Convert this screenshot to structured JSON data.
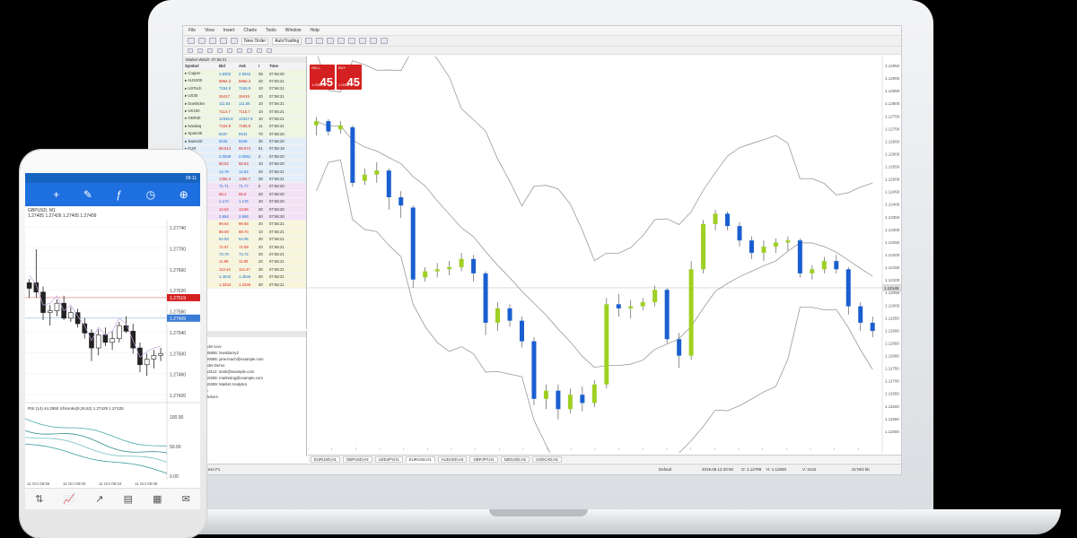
{
  "desktop": {
    "menu": [
      "File",
      "View",
      "Insert",
      "Charts",
      "Tools",
      "Window",
      "Help"
    ],
    "toolbar": {
      "new_order": "New Order",
      "auto_trading": "AutoTrading"
    },
    "market_watch": {
      "title": "Market Watch: 07:56:21",
      "headers": [
        "Symbol",
        "Bid",
        "Ask",
        "!",
        "Time"
      ],
      "rows": [
        {
          "symbol": "Copper",
          "bid": "2.8303",
          "ask": "2.8342",
          "spread": "39",
          "time": "07:56:20",
          "color": "green",
          "dir": "up"
        },
        {
          "symbol": "AUS200",
          "bid": "5964.3",
          "ask": "5966.3",
          "spread": "20",
          "time": "07:56:21",
          "color": "green",
          "dir": "dn"
        },
        {
          "symbol": "USTech",
          "bid": "7154.9",
          "ask": "7155.9",
          "spread": "10",
          "time": "07:56:21",
          "color": "green",
          "dir": "up"
        },
        {
          "symbol": "US30",
          "bid": "26417",
          "ask": "26419",
          "spread": "20",
          "time": "07:56:21",
          "color": "green",
          "dir": "dn"
        },
        {
          "symbol": "Dowlndex",
          "bid": "111.54",
          "ask": "111.55",
          "spread": "10",
          "time": "07:56:21",
          "color": "green",
          "dir": "up"
        },
        {
          "symbol": "UK100",
          "bid": "7114.7",
          "ask": "7115.7",
          "spread": "10",
          "time": "07:56:21",
          "color": "green",
          "dir": "dn"
        },
        {
          "symbol": "GER30",
          "bid": "12346.9",
          "ask": "12347.9",
          "spread": "10",
          "time": "07:56:21",
          "color": "green",
          "dir": "up"
        },
        {
          "symbol": "Nasdaq",
          "bid": "7154.8",
          "ask": "7155.9",
          "spread": "11",
          "time": "07:56:21",
          "color": "green",
          "dir": "dn"
        },
        {
          "symbol": "Spain35",
          "bid": "9437",
          "ask": "9444",
          "spread": "70",
          "time": "07:56:20",
          "color": "green",
          "dir": "up"
        },
        {
          "symbol": "Swiss20",
          "bid": "9245",
          "ask": "9248",
          "spread": "30",
          "time": "07:56:20",
          "color": "blue",
          "dir": "up"
        },
        {
          "symbol": "EUR",
          "bid": "88.813",
          "ask": "88.874",
          "spread": "61",
          "time": "07:56:19",
          "color": "blue",
          "dir": "dn"
        },
        {
          "symbol": "GBP",
          "bid": "2.0049",
          "ask": "2.0051",
          "spread": "2",
          "time": "07:56:20",
          "color": "blue",
          "dir": "up"
        },
        {
          "symbol": "USD",
          "bid": "88.53",
          "ask": "88.63",
          "spread": "10",
          "time": "07:56:20",
          "color": "blue",
          "dir": "dn"
        },
        {
          "symbol": "JPY",
          "bid": "14.78",
          "ask": "14.82",
          "spread": "40",
          "time": "07:56:21",
          "color": "blue",
          "dir": "up"
        },
        {
          "symbol": "CHF",
          "bid": "1356.4",
          "ask": "1356.7",
          "spread": "30",
          "time": "07:56:21",
          "color": "blue",
          "dir": "dn"
        },
        {
          "symbol": "Gold",
          "bid": "71.71",
          "ask": "71.77",
          "spread": "6",
          "time": "07:56:20",
          "color": "pink",
          "dir": "up"
        },
        {
          "symbol": "Silver",
          "bid": "65.4",
          "ask": "65.6",
          "spread": "20",
          "time": "07:56:20",
          "color": "pink",
          "dir": "dn"
        },
        {
          "symbol": "Brent",
          "bid": "1.172",
          "ask": "1.176",
          "spread": "40",
          "time": "07:56:20",
          "color": "pink",
          "dir": "up"
        },
        {
          "symbol": "WTI",
          "bid": "13.54",
          "ask": "13.56",
          "spread": "20",
          "time": "07:56:20",
          "color": "pink",
          "dir": "dn"
        },
        {
          "symbol": "NatGas",
          "bid": "2.654",
          "ask": "2.659",
          "spread": "50",
          "time": "07:56:20",
          "color": "pink",
          "dir": "up"
        },
        {
          "symbol": "EURUSD",
          "bid": "99.64",
          "ask": "99.66",
          "spread": "20",
          "time": "07:56:21",
          "color": "yellow",
          "dir": "dn"
        },
        {
          "symbol": "GBPUSD",
          "bid": "88.69",
          "ask": "88.70",
          "spread": "10",
          "time": "07:56:21",
          "color": "yellow",
          "dir": "dn"
        },
        {
          "symbol": "USDJPY",
          "bid": "64.93",
          "ask": "64.95",
          "spread": "20",
          "time": "07:56:21",
          "color": "yellow",
          "dir": "up"
        },
        {
          "symbol": "AUDUSD",
          "bid": "72.57",
          "ask": "72.59",
          "spread": "20",
          "time": "07:56:21",
          "color": "yellow",
          "dir": "dn"
        },
        {
          "symbol": "USDCAD",
          "bid": "73.70",
          "ask": "73.72",
          "spread": "20",
          "time": "07:56:21",
          "color": "yellow",
          "dir": "up"
        },
        {
          "symbol": "NZDUSD",
          "bid": "11.88",
          "ask": "11.90",
          "spread": "20",
          "time": "07:56:21",
          "color": "yellow",
          "dir": "dn"
        },
        {
          "symbol": "EURGBP",
          "bid": "112.44",
          "ask": "112.47",
          "spread": "30",
          "time": "07:56:21",
          "color": "yellow",
          "dir": "dn"
        },
        {
          "symbol": "EURJPY",
          "bid": "1.4543",
          "ask": "1.4546",
          "spread": "30",
          "time": "07:56:21",
          "color": "yellow",
          "dir": "up"
        },
        {
          "symbol": "EURCHF",
          "bid": "1.3343",
          "ask": "1.3346",
          "spread": "30",
          "time": "07:56:21",
          "color": "yellow",
          "dir": "dn"
        }
      ]
    },
    "navigator": {
      "title": "Navigator",
      "items": [
        {
          "label": "Accounts",
          "level": 0,
          "icon": "folder"
        },
        {
          "label": "AxiTrader-Live",
          "level": 1,
          "icon": "server"
        },
        {
          "label": "1465856: lewisbarry2",
          "level": 2,
          "icon": "account"
        },
        {
          "label": "2800685: jane.leach@example.com",
          "level": 2,
          "icon": "account"
        },
        {
          "label": "AxiTrader-Demo",
          "level": 1,
          "icon": "server"
        },
        {
          "label": "4953112: mark@example.com",
          "level": 2,
          "icon": "account"
        },
        {
          "label": "4850285: marketing@example.com",
          "level": 2,
          "icon": "account"
        },
        {
          "label": "4850289: Market Analytics",
          "level": 2,
          "icon": "account"
        },
        {
          "label": "Indicators",
          "level": 0,
          "icon": "folder"
        },
        {
          "label": "Expert Advisors",
          "level": 0,
          "icon": "folder"
        }
      ],
      "tabs": [
        "Common",
        "Favorites"
      ]
    },
    "one_click": {
      "sell_label": "SELL",
      "buy_label": "BUY",
      "lot": "1.00",
      "sell_price_small": "1.0956",
      "sell_price_big": "45",
      "buy_price_small": "1.0958",
      "buy_price_big": "45"
    },
    "chart_tabs": [
      "EURUSD,H1",
      "GBPUSD,H4",
      "USDJPY,H1",
      "EURUSD,H1",
      "AUDUSD,H4",
      "GBPJPY,H1",
      "NZDUSD,H1",
      "USDCAD,H1"
    ],
    "active_chart_tab": 3,
    "status": {
      "help": "For Help, press F1",
      "profile": "Default",
      "datetime": "2019.06.13 20:00",
      "open": "O: 1.12789",
      "high": "H: 1.12830",
      "volume": "V: 3142",
      "traffic": "2178/4 kb"
    },
    "price_scale": [
      "1.12950",
      "1.12900",
      "1.12850",
      "1.12800",
      "1.12750",
      "1.12700",
      "1.12650",
      "1.12600",
      "1.12550",
      "1.12500",
      "1.12450",
      "1.12400",
      "1.12350",
      "1.12300",
      "1.12250",
      "1.12200",
      "1.12150",
      "1.12100",
      "1.12050",
      "1.12000",
      "1.11950",
      "1.11900",
      "1.11850",
      "1.11800",
      "1.11750",
      "1.11700",
      "1.11650",
      "1.11600",
      "1.11550",
      "1.11500"
    ],
    "current_price": "1.12145",
    "colors": {
      "bull": "#9ed022",
      "bear": "#1a5fd0",
      "bands": "#9a9a9a",
      "sell_buy": "#d42020"
    }
  },
  "phone": {
    "clock": "09:11",
    "symbol": "GBPUSD, M1",
    "ohlc": "1.27405 1.27426 1.27405 1.27409",
    "indicator": "RSI (14) 44.2950  Ichimoku(9,26,52) 1.27429 1.27425",
    "price_scale": [
      "1.27740",
      "1.27700",
      "1.27660",
      "1.27620",
      "1.27580",
      "1.27540",
      "1.27500",
      "1.27460",
      "1.27420"
    ],
    "current_price_label": "1.27409",
    "ask_label": "1.27519",
    "ind_scale": [
      "100.00",
      "50.00",
      "0.00"
    ],
    "time_labels": [
      "11 Oct 08:56",
      "11 Oct 09:00",
      "11 Oct 09:04",
      "11 Oct 09:08"
    ],
    "colors": {
      "accent": "#1e6fe0",
      "price_tag": "#d42020"
    }
  },
  "chart_data": [
    {
      "type": "line",
      "title": "",
      "note": "Desktop candlestick chart with Bollinger Bands",
      "candles": [
        [
          1.1284,
          1.1288,
          1.1279,
          1.1286,
          "bull"
        ],
        [
          1.1286,
          1.1287,
          1.1279,
          1.1281,
          "bear"
        ],
        [
          1.1282,
          1.1286,
          1.128,
          1.1284,
          "bull"
        ],
        [
          1.1283,
          1.1284,
          1.1254,
          1.1256,
          "bear"
        ],
        [
          1.1257,
          1.1263,
          1.1255,
          1.126,
          "bull"
        ],
        [
          1.126,
          1.1266,
          1.1256,
          1.1262,
          "bull"
        ],
        [
          1.1262,
          1.1263,
          1.1243,
          1.1249,
          "bear"
        ],
        [
          1.1249,
          1.1252,
          1.1239,
          1.1245,
          "bear"
        ],
        [
          1.1244,
          1.1245,
          1.1205,
          1.1209,
          "bear"
        ],
        [
          1.121,
          1.1215,
          1.1208,
          1.1213,
          "bull"
        ],
        [
          1.1213,
          1.1217,
          1.121,
          1.1214,
          "bull"
        ],
        [
          1.1214,
          1.1218,
          1.1211,
          1.1215,
          "bull"
        ],
        [
          1.1215,
          1.1222,
          1.1213,
          1.1219,
          "bull"
        ],
        [
          1.1219,
          1.1221,
          1.1208,
          1.1212,
          "bear"
        ],
        [
          1.1212,
          1.1213,
          1.1182,
          1.1188,
          "bear"
        ],
        [
          1.1188,
          1.1198,
          1.1184,
          1.1195,
          "bull"
        ],
        [
          1.1195,
          1.1197,
          1.1186,
          1.1189,
          "bear"
        ],
        [
          1.1189,
          1.1191,
          1.1176,
          1.1179,
          "bear"
        ],
        [
          1.1179,
          1.1181,
          1.1148,
          1.1151,
          "bear"
        ],
        [
          1.1151,
          1.1158,
          1.1146,
          1.1155,
          "bull"
        ],
        [
          1.1155,
          1.1158,
          1.1141,
          1.1146,
          "bear"
        ],
        [
          1.1146,
          1.1156,
          1.1144,
          1.1153,
          "bull"
        ],
        [
          1.1153,
          1.1157,
          1.1145,
          1.1149,
          "bear"
        ],
        [
          1.1149,
          1.116,
          1.1147,
          1.1158,
          "bull"
        ],
        [
          1.1158,
          1.12,
          1.1156,
          1.1197,
          "bull"
        ],
        [
          1.1197,
          1.1202,
          1.1191,
          1.1195,
          "bear"
        ],
        [
          1.1195,
          1.1199,
          1.119,
          1.1196,
          "bull"
        ],
        [
          1.1196,
          1.12,
          1.1194,
          1.1198,
          "bull"
        ],
        [
          1.1198,
          1.1206,
          1.1196,
          1.1204,
          "bull"
        ],
        [
          1.1204,
          1.1205,
          1.1178,
          1.118,
          "bear"
        ],
        [
          1.118,
          1.1183,
          1.1166,
          1.1172,
          "bear"
        ],
        [
          1.1172,
          1.1218,
          1.117,
          1.1214,
          "bull"
        ],
        [
          1.1214,
          1.1238,
          1.1212,
          1.1236,
          "bull"
        ],
        [
          1.1236,
          1.1243,
          1.1233,
          1.1241,
          "bull"
        ],
        [
          1.1241,
          1.1242,
          1.1233,
          1.1235,
          "bear"
        ],
        [
          1.1235,
          1.1237,
          1.1225,
          1.1228,
          "bear"
        ],
        [
          1.1228,
          1.123,
          1.1219,
          1.1222,
          "bear"
        ],
        [
          1.1222,
          1.1228,
          1.1218,
          1.1225,
          "bull"
        ],
        [
          1.1225,
          1.1229,
          1.1222,
          1.1227,
          "bull"
        ],
        [
          1.1227,
          1.123,
          1.1223,
          1.1228,
          "bull"
        ],
        [
          1.1228,
          1.1229,
          1.121,
          1.1212,
          "bear"
        ],
        [
          1.1212,
          1.1216,
          1.1209,
          1.1214,
          "bull"
        ],
        [
          1.1214,
          1.122,
          1.1212,
          1.1218,
          "bull"
        ],
        [
          1.1218,
          1.1221,
          1.1212,
          1.1214,
          "bear"
        ],
        [
          1.1214,
          1.1215,
          1.1192,
          1.1196,
          "bear"
        ],
        [
          1.1196,
          1.1198,
          1.1184,
          1.1188,
          "bear"
        ],
        [
          1.1188,
          1.1191,
          1.1181,
          1.1184,
          "bear"
        ]
      ],
      "ylim": [
        1.113,
        1.13
      ]
    },
    {
      "type": "line",
      "title": "",
      "note": "Phone GBPUSD M1 candles",
      "candles": [
        [
          1.2757,
          1.2762,
          1.2752,
          1.276,
          "bear"
        ],
        [
          1.276,
          1.2778,
          1.2752,
          1.2755,
          "bear"
        ],
        [
          1.2755,
          1.2758,
          1.274,
          1.2744,
          "bear"
        ],
        [
          1.2744,
          1.2748,
          1.2737,
          1.2745,
          "bull"
        ],
        [
          1.2745,
          1.2751,
          1.2742,
          1.2749,
          "bull"
        ],
        [
          1.2749,
          1.2753,
          1.274,
          1.2741,
          "bear"
        ],
        [
          1.2741,
          1.2747,
          1.2739,
          1.2744,
          "bull"
        ],
        [
          1.2744,
          1.2746,
          1.2736,
          1.2738,
          "bear"
        ],
        [
          1.2738,
          1.2741,
          1.273,
          1.2733,
          "bear"
        ],
        [
          1.2733,
          1.2735,
          1.2718,
          1.2725,
          "bear"
        ],
        [
          1.2725,
          1.2735,
          1.2721,
          1.2732,
          "bull"
        ],
        [
          1.2732,
          1.2736,
          1.2726,
          1.2728,
          "bear"
        ],
        [
          1.2728,
          1.2734,
          1.2724,
          1.273,
          "bull"
        ],
        [
          1.273,
          1.2739,
          1.2728,
          1.2737,
          "bull"
        ],
        [
          1.2737,
          1.2742,
          1.2733,
          1.2734,
          "bear"
        ],
        [
          1.2734,
          1.2738,
          1.2722,
          1.2725,
          "bear"
        ],
        [
          1.2725,
          1.2728,
          1.2712,
          1.2716,
          "bear"
        ],
        [
          1.2716,
          1.2722,
          1.271,
          1.2719,
          "bull"
        ],
        [
          1.2719,
          1.2724,
          1.2714,
          1.2721,
          "bull"
        ],
        [
          1.2721,
          1.2725,
          1.2718,
          1.2722,
          "bull"
        ]
      ],
      "ylim": [
        1.27,
        1.279
      ]
    }
  ]
}
